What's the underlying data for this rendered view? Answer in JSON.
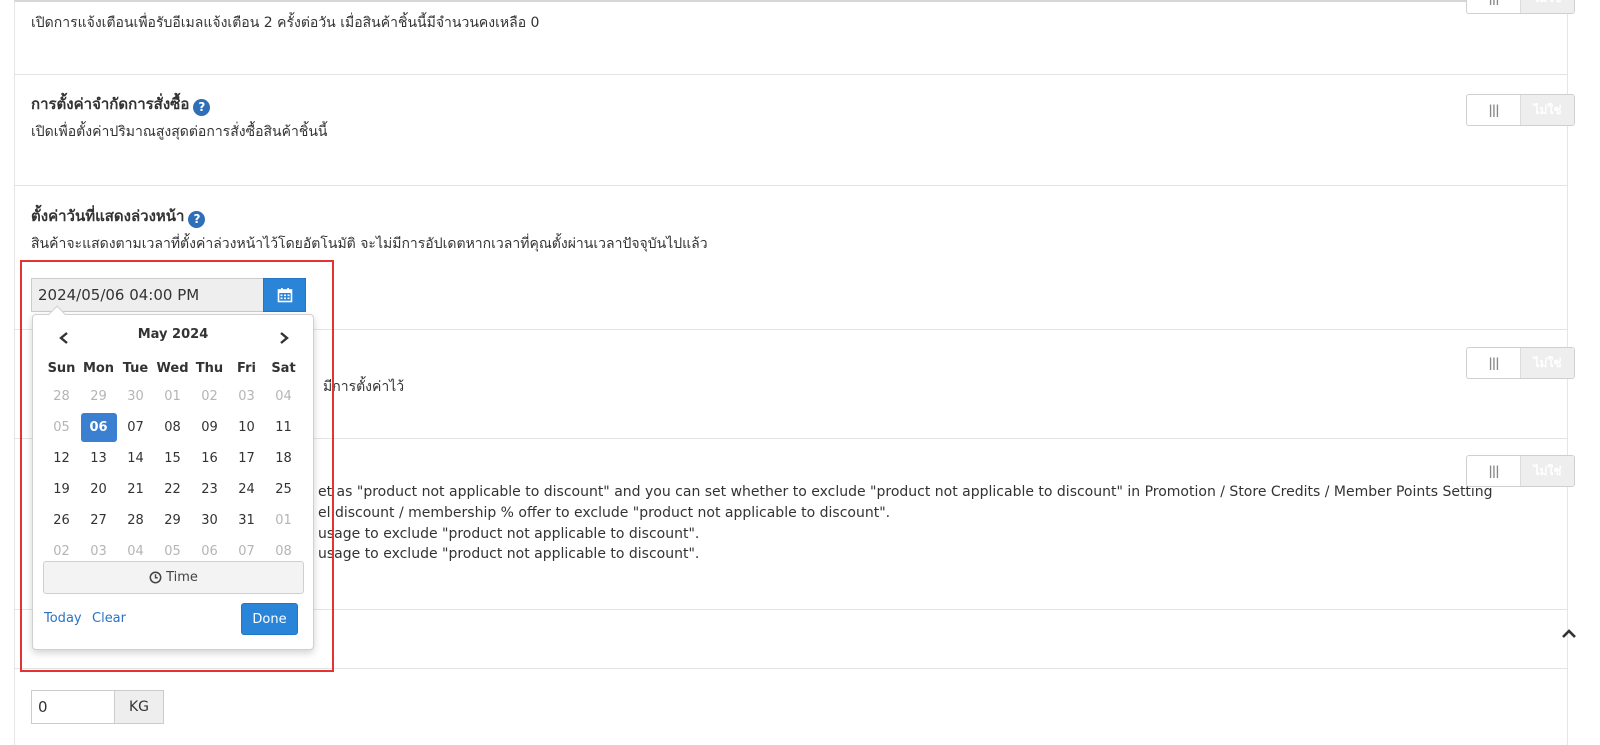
{
  "stock_alert": {
    "desc": "เปิดการแจ้งเตือนเพื่อรับอีเมลแจ้งเตือน 2 ครั้งต่อวัน เมื่อสินค้าชิ้นนี้มีจำนวนคงเหลือ 0",
    "toggle_label": "ไม่ใช่"
  },
  "purchase_limit": {
    "title": "การตั้งค่าจำกัดการสั่งซื้อ",
    "desc": "เปิดเพื่อตั้งค่าปริมาณสูงสุดต่อการสั่งซื้อสินค้าชิ้นนี้",
    "toggle_label": "ไม่ใช่"
  },
  "schedule": {
    "title": "ตั้งค่าวันที่แสดงล่วงหน้า",
    "desc": "สินค้าจะแสดงตามเวลาที่ตั้งค่าล่วงหน้าไว้โดยอัตโนมัติ จะไม่มีการอัปเดตหากเวลาที่คุณตั้งผ่านเวลาปัจจุบันไปแล้ว",
    "value": "2024/05/06 04:00 PM"
  },
  "hidden_setting": {
    "desc_fragment": "มีการตั้งค่าไว้",
    "toggle_label": "ไม่ใช่"
  },
  "discount_exclusion": {
    "toggle_label": "ไม่ใช่",
    "lines": [
      "et as \"product not applicable to discount\" and you can set whether to exclude \"product not applicable to discount\" in Promotion / Store Credits / Member Points Setting",
      "el discount / membership % offer to exclude \"product not applicable to discount\".",
      "usage to exclude \"product not applicable to discount\".",
      " usage to exclude \"product not applicable to discount\"."
    ]
  },
  "datepicker": {
    "month_label": "May 2024",
    "weekdays": [
      "Sun",
      "Mon",
      "Tue",
      "Wed",
      "Thu",
      "Fri",
      "Sat"
    ],
    "weeks": [
      [
        "28",
        "29",
        "30",
        "01",
        "02",
        "03",
        "04"
      ],
      [
        "05",
        "06",
        "07",
        "08",
        "09",
        "10",
        "11"
      ],
      [
        "12",
        "13",
        "14",
        "15",
        "16",
        "17",
        "18"
      ],
      [
        "19",
        "20",
        "21",
        "22",
        "23",
        "24",
        "25"
      ],
      [
        "26",
        "27",
        "28",
        "29",
        "30",
        "31",
        "01"
      ],
      [
        "02",
        "03",
        "04",
        "05",
        "06",
        "07",
        "08"
      ]
    ],
    "selected_day": "06",
    "time_label": "Time",
    "today_label": "Today",
    "clear_label": "Clear",
    "done_label": "Done"
  },
  "weight": {
    "value": "0",
    "unit": "KG"
  },
  "icons": {
    "help": "question-circle-icon",
    "calendar": "calendar-icon",
    "clock": "clock-icon",
    "chevron_up": "chevron-up-icon",
    "prev": "chevron-left-icon",
    "next": "chevron-right-icon"
  },
  "colors": {
    "primary": "#2a85d8",
    "help_icon": "#2e6fb7",
    "selected_day": "#3a7fd0",
    "highlight_border": "#e53333",
    "link": "#2a73c4"
  }
}
